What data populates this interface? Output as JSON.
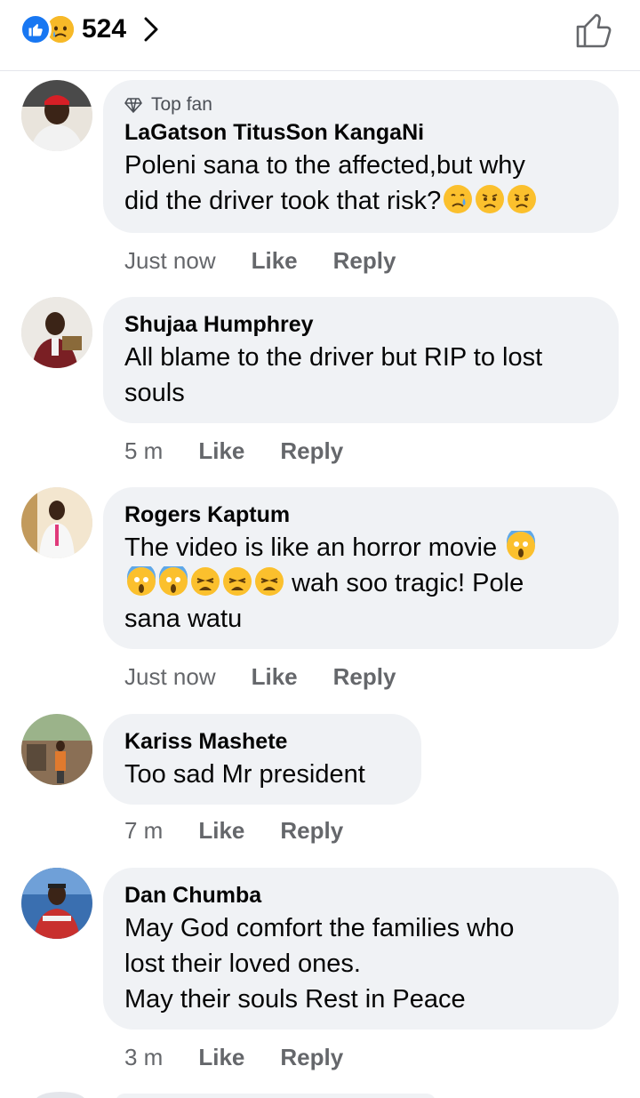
{
  "header": {
    "reaction_count": "524",
    "colors": {
      "like": "#1877f2",
      "sad": "#f7b928"
    }
  },
  "comments": [
    {
      "author": "LaGatson TitusSon KangaNi",
      "badge": "Top fan",
      "text": "Poleni sana to the affected,but why\ndid the driver took that risk?",
      "emojis": [
        "sad-tear-emoji",
        "sad-emoji",
        "sad-emoji"
      ],
      "time": "Just now",
      "like_label": "Like",
      "reply_label": "Reply"
    },
    {
      "author": "Shujaa Humphrey",
      "text": "All blame to the driver but RIP to lost\nsouls",
      "time": "5 m",
      "like_label": "Like",
      "reply_label": "Reply"
    },
    {
      "author": "Rogers Kaptum",
      "text_part1": "The video is like an horror movie",
      "text_part2": "wah soo tragic! Pole",
      "text_part3": "sana watu",
      "emojis": [
        "scream-emoji",
        "scream-emoji",
        "scream-emoji",
        "weary-emoji",
        "weary-emoji",
        "weary-emoji"
      ],
      "time": "Just now",
      "like_label": "Like",
      "reply_label": "Reply"
    },
    {
      "author": "Kariss Mashete",
      "text": "Too sad Mr president",
      "time": "7 m",
      "like_label": "Like",
      "reply_label": "Reply"
    },
    {
      "author": "Dan Chumba",
      "text": "May God comfort the families who\nlost their loved ones.\nMay their souls Rest in Peace",
      "time": "3 m",
      "like_label": "Like",
      "reply_label": "Reply"
    }
  ]
}
